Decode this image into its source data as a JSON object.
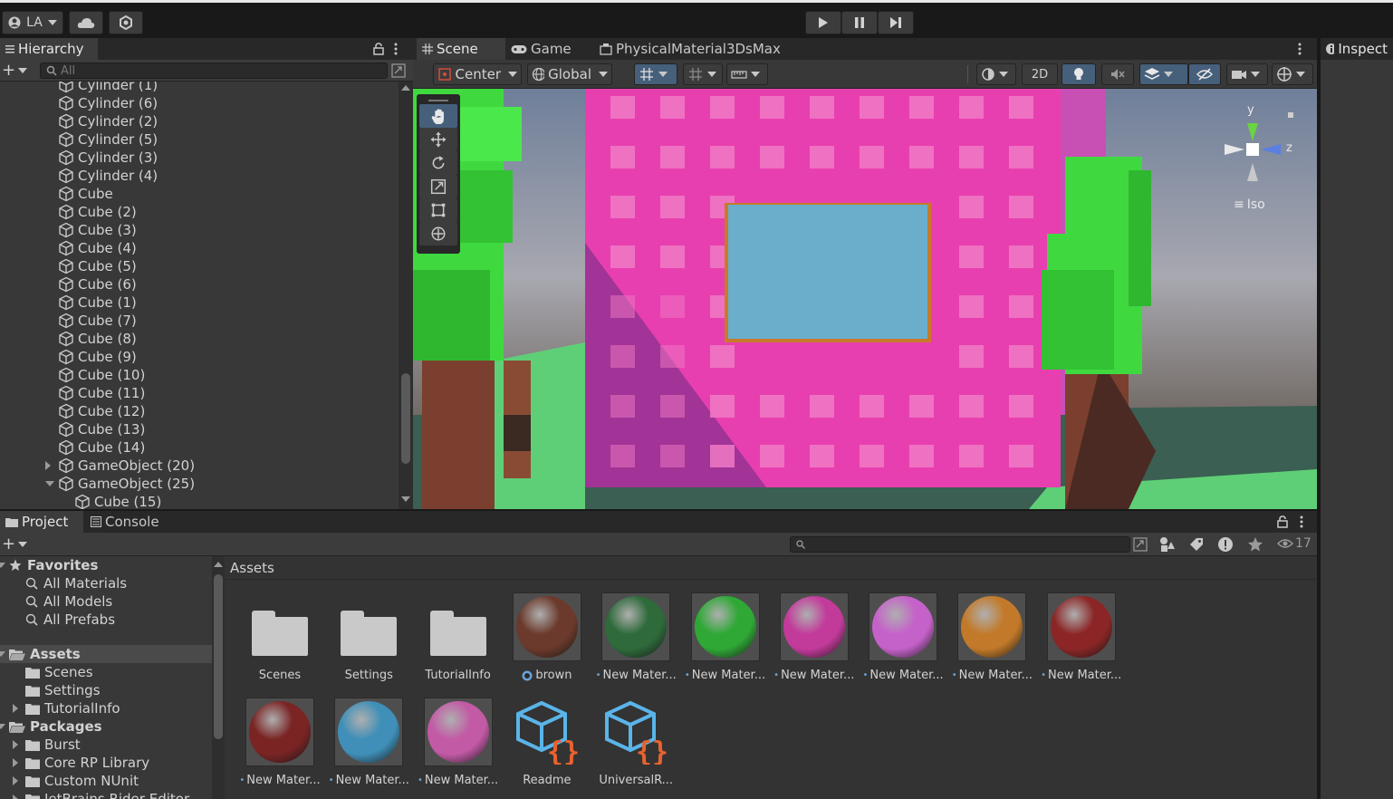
{
  "topbar": {
    "account_label": "LA",
    "cloud_icon": "cloud-icon",
    "collab_icon": "collab-icon",
    "play_icon": "play-icon",
    "pause_icon": "pause-icon",
    "step_icon": "step-icon"
  },
  "hierarchy": {
    "tab_label": "Hierarchy",
    "search_placeholder": "All",
    "items": [
      {
        "label": "Cylinder (1)",
        "indent": 2,
        "arrow": ""
      },
      {
        "label": "Cylinder (6)",
        "indent": 2,
        "arrow": ""
      },
      {
        "label": "Cylinder (2)",
        "indent": 2,
        "arrow": ""
      },
      {
        "label": "Cylinder (5)",
        "indent": 2,
        "arrow": ""
      },
      {
        "label": "Cylinder (3)",
        "indent": 2,
        "arrow": ""
      },
      {
        "label": "Cylinder (4)",
        "indent": 2,
        "arrow": ""
      },
      {
        "label": "Cube",
        "indent": 2,
        "arrow": ""
      },
      {
        "label": "Cube (2)",
        "indent": 2,
        "arrow": ""
      },
      {
        "label": "Cube (3)",
        "indent": 2,
        "arrow": ""
      },
      {
        "label": "Cube (4)",
        "indent": 2,
        "arrow": ""
      },
      {
        "label": "Cube (5)",
        "indent": 2,
        "arrow": ""
      },
      {
        "label": "Cube (6)",
        "indent": 2,
        "arrow": ""
      },
      {
        "label": "Cube (1)",
        "indent": 2,
        "arrow": ""
      },
      {
        "label": "Cube (7)",
        "indent": 2,
        "arrow": ""
      },
      {
        "label": "Cube (8)",
        "indent": 2,
        "arrow": ""
      },
      {
        "label": "Cube (9)",
        "indent": 2,
        "arrow": ""
      },
      {
        "label": "Cube (10)",
        "indent": 2,
        "arrow": ""
      },
      {
        "label": "Cube (11)",
        "indent": 2,
        "arrow": ""
      },
      {
        "label": "Cube (12)",
        "indent": 2,
        "arrow": ""
      },
      {
        "label": "Cube (13)",
        "indent": 2,
        "arrow": ""
      },
      {
        "label": "Cube (14)",
        "indent": 2,
        "arrow": ""
      },
      {
        "label": "GameObject (20)",
        "indent": 2,
        "arrow": "right"
      },
      {
        "label": "GameObject (25)",
        "indent": 2,
        "arrow": "down"
      },
      {
        "label": "Cube (15)",
        "indent": 3,
        "arrow": ""
      }
    ]
  },
  "scene": {
    "tabs": [
      {
        "label": "Scene",
        "icon": "grid-icon",
        "active": true
      },
      {
        "label": "Game",
        "icon": "gamepad-icon",
        "active": false
      },
      {
        "label": "PhysicalMaterial3DsMax",
        "icon": "material-icon",
        "active": false
      }
    ],
    "pivot_label": "Center",
    "space_label": "Global",
    "mode_2d_label": "2D",
    "gizmo_y": "y",
    "gizmo_z": "z",
    "gizmo_iso": "Iso"
  },
  "inspector": {
    "tab_label": "Inspect"
  },
  "project": {
    "tabs": [
      {
        "label": "Project",
        "active": true
      },
      {
        "label": "Console",
        "active": false
      }
    ],
    "hidden_count": "17",
    "breadcrumb": "Assets",
    "tree": [
      {
        "label": "Favorites",
        "level": 0,
        "kind": "star",
        "bold": true
      },
      {
        "label": "All Materials",
        "level": 1,
        "kind": "search",
        "bold": false
      },
      {
        "label": "All Models",
        "level": 1,
        "kind": "search",
        "bold": false
      },
      {
        "label": "All Prefabs",
        "level": 1,
        "kind": "search",
        "bold": false
      },
      {
        "label": "Assets",
        "level": 0,
        "kind": "folder-open",
        "bold": true
      },
      {
        "label": "Scenes",
        "level": 1,
        "kind": "folder",
        "bold": false
      },
      {
        "label": "Settings",
        "level": 1,
        "kind": "folder",
        "bold": false
      },
      {
        "label": "TutorialInfo",
        "level": 1,
        "kind": "folder",
        "bold": false,
        "arrow": true
      },
      {
        "label": "Packages",
        "level": 0,
        "kind": "folder-open",
        "bold": true
      },
      {
        "label": "Burst",
        "level": 1,
        "kind": "folder",
        "bold": false,
        "arrow": true
      },
      {
        "label": "Core RP Library",
        "level": 1,
        "kind": "folder",
        "bold": false,
        "arrow": true
      },
      {
        "label": "Custom NUnit",
        "level": 1,
        "kind": "folder",
        "bold": false,
        "arrow": true
      },
      {
        "label": "JetBrains Rider Editor",
        "level": 1,
        "kind": "folder",
        "bold": false,
        "arrow": true
      }
    ],
    "assets": [
      {
        "label": "Scenes",
        "kind": "folder",
        "color": ""
      },
      {
        "label": "Settings",
        "kind": "folder",
        "color": ""
      },
      {
        "label": "TutorialInfo",
        "kind": "folder",
        "color": ""
      },
      {
        "label": "brown",
        "kind": "material",
        "color": "#6b3a2c"
      },
      {
        "label": "New Mater...",
        "kind": "material",
        "color": "#2e6a3a"
      },
      {
        "label": "New Mater...",
        "kind": "material",
        "color": "#2fa836"
      },
      {
        "label": "New Mater...",
        "kind": "material",
        "color": "#c23a9a"
      },
      {
        "label": "New Mater...",
        "kind": "material",
        "color": "#c562c9"
      },
      {
        "label": "New Mater...",
        "kind": "material",
        "color": "#c27a2a"
      },
      {
        "label": "New Mater...",
        "kind": "material",
        "color": "#8c2626"
      },
      {
        "label": "New Mater...",
        "kind": "material",
        "color": "#7a2424"
      },
      {
        "label": "New Mater...",
        "kind": "material",
        "color": "#3f8fb8"
      },
      {
        "label": "New Mater...",
        "kind": "material",
        "color": "#c25aa5"
      },
      {
        "label": "Readme",
        "kind": "script",
        "color": ""
      },
      {
        "label": "UniversalR...",
        "kind": "script",
        "color": ""
      }
    ]
  },
  "colors": {
    "building": "#e83fb0",
    "window": "#f07ac4",
    "glass": "#6aaecc",
    "frame": "#c87a2a",
    "foliage": "#3fd93f",
    "trunk": "#7a3f2e",
    "sky": "#a8a8b0"
  }
}
